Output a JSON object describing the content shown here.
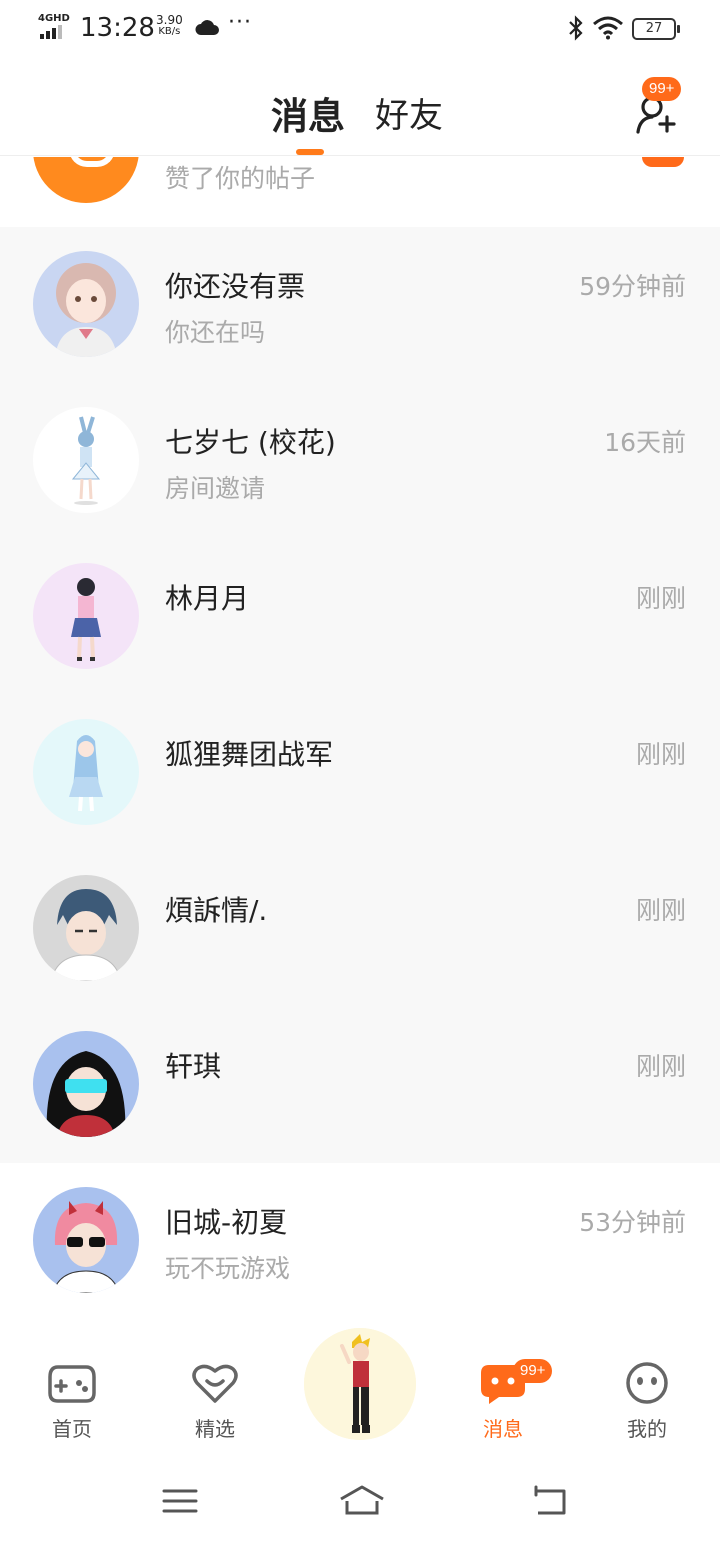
{
  "status_bar": {
    "network": "4GHD",
    "time": "13:28",
    "speed_value": "3.90",
    "speed_unit": "KB/s",
    "dots": "···",
    "battery": "27"
  },
  "header": {
    "tabs": [
      {
        "label": "消息",
        "active": true
      },
      {
        "label": "好友",
        "active": false
      }
    ],
    "add_friend_badge": "99+"
  },
  "partial_row": {
    "preview": "赞了你的帖子"
  },
  "conversations": [
    {
      "name": "你还没有票",
      "time": "59分钟前",
      "preview": "你还在吗",
      "avatar_bg": "#c9d6f2",
      "hair": "#d9b8b0",
      "outfit": "#f0f0f0"
    },
    {
      "name": "七岁七   (校花)",
      "time": "16天前",
      "preview": "房间邀请",
      "avatar_bg": "#ffffff",
      "hair": "#8fb6d8",
      "outfit": "#cfe3f4"
    },
    {
      "name": "林月月",
      "time": "刚刚",
      "preview": "",
      "avatar_bg": "#f4e4f8",
      "hair": "#2a2a33",
      "outfit": "#4b63a8"
    },
    {
      "name": "狐狸舞团战军",
      "time": "刚刚",
      "preview": "",
      "avatar_bg": "#e4f8fa",
      "hair": "#9cc6ea",
      "outfit": "#b9d8f2"
    },
    {
      "name": "煩訴情/.",
      "time": "刚刚",
      "preview": "",
      "avatar_bg": "#d8d8d8",
      "hair": "#3d5a78",
      "outfit": "#ffffff"
    },
    {
      "name": "轩琪",
      "time": "刚刚",
      "preview": "",
      "avatar_bg": "#a9c1ee",
      "hair": "#111111",
      "outfit": "#c0303a"
    },
    {
      "name": "旧城-初夏",
      "time": "53分钟前",
      "preview": "玩不玩游戏",
      "avatar_bg": "#a9c1ee",
      "hair": "#f08aa0",
      "outfit": "#ffffff"
    }
  ],
  "bottom_nav": {
    "items": [
      {
        "label": "首页",
        "icon": "gamepad-icon",
        "active": false
      },
      {
        "label": "精选",
        "icon": "heart-chat-icon",
        "active": false
      },
      {
        "label": "消息",
        "icon": "message-bubble-icon",
        "active": true,
        "badge": "99+"
      },
      {
        "label": "我的",
        "icon": "smiley-face-icon",
        "active": false
      }
    ]
  },
  "colors": {
    "accent": "#ff6a1a",
    "muted_text": "#aaaaaa",
    "list_bg": "#f8f8f8"
  },
  "system_nav": {
    "icons": [
      "menu-icon",
      "home-icon",
      "back-icon"
    ]
  }
}
